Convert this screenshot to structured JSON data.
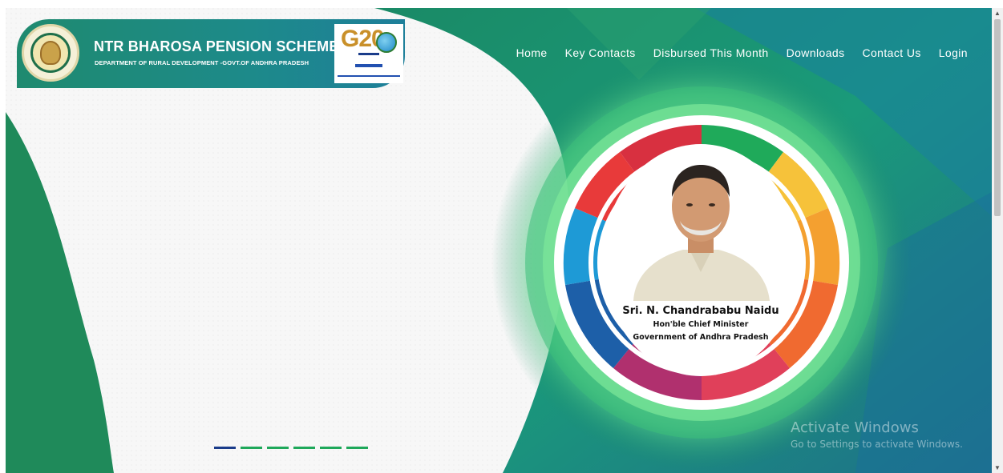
{
  "brand": {
    "title": "NTR BHAROSA PENSION SCHEME",
    "subtitle": "DEPARTMENT OF RURAL DEVELOPMENT -GOVT.OF ANDHRA PRADESH",
    "g20_text": "G20"
  },
  "nav": {
    "items": [
      "Home",
      "Key Contacts",
      "Disbursed This Month",
      "Downloads",
      "Contact Us",
      "Login"
    ]
  },
  "portrait": {
    "name": "Sri. N. Chandrababu Naidu",
    "role": "Hon'ble Chief Minister",
    "govt": "Government of Andhra Pradesh"
  },
  "slider": {
    "count": 6,
    "active_index": 0
  },
  "watermark": {
    "title": "Activate Windows",
    "subtitle": "Go to Settings to activate Windows."
  },
  "colors": {
    "brand_green": "#1f8a6f",
    "nav_text": "#ffffff",
    "indicator": "#1ea85a",
    "indicator_active": "#1a3c8a"
  }
}
